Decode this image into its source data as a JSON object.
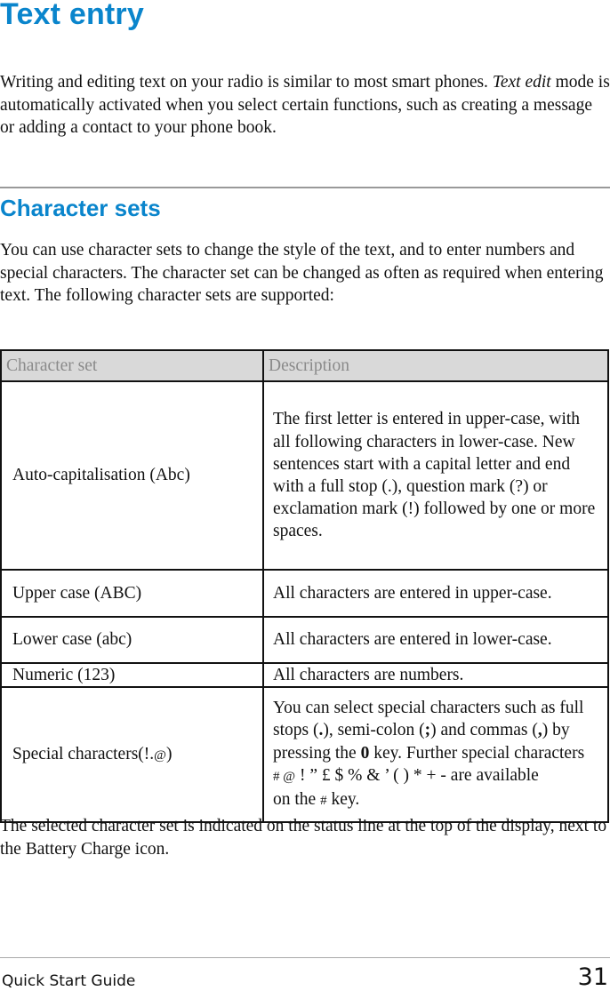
{
  "title": "Text entry",
  "intro": {
    "text_before_italic": "",
    "line1": "Writing and editing text on your radio is similar to most smart phones.",
    "italic_term": "Text edit",
    "rest": " mode is automatically activated when you select certain functions, such as creating a message or adding a contact to your phone book."
  },
  "section": {
    "heading": "Character sets",
    "body": "You can use character sets to change the style of the text, and to enter numbers and special characters. The character set can be changed as often as required when entering text. The following character sets are supported:"
  },
  "table": {
    "headers": [
      "Character set",
      "Description"
    ],
    "rows": [
      {
        "set": "Auto-capitalisation (Abc)",
        "description": "The first letter is entered in upper-case, with all following characters in lower-case. New sentences start with a capital letter and end with a full stop (.), question mark (?) or exclamation mark (!) followed by one or more spaces."
      },
      {
        "set": "Upper case (ABC)",
        "description": "All characters are entered in upper-case."
      },
      {
        "set": "Lower case (abc)",
        "description": "All characters are entered in lower-case."
      },
      {
        "set": "Numeric (123)",
        "description": "All characters are numbers."
      },
      {
        "set_main": "Special characters(!.",
        "set_symbol": "@",
        "set_end": ")",
        "desc_part1": "You can select special characters such as full stops (",
        "desc_dot": ".",
        "desc_part2": "), semi-colon (",
        "desc_semicolon": ";",
        "desc_part3": ") and commas (",
        "desc_comma": ",",
        "desc_part4": ") by pressing the ",
        "desc_key_zero": "0",
        "desc_part5": " key. Further special characters",
        "desc_symbols_a": "# @",
        "desc_symbols_b": " ! ” £ $ % & ’ ( ) * + - are available",
        "desc_part6": "on the ",
        "desc_hash": "#",
        "desc_part7": " key."
      }
    ]
  },
  "outro": "The selected character set is indicated on the status line at the top of the display, next to the Battery Charge icon.",
  "footer": {
    "guide_name": "Quick Start Guide",
    "page_number": "31"
  }
}
